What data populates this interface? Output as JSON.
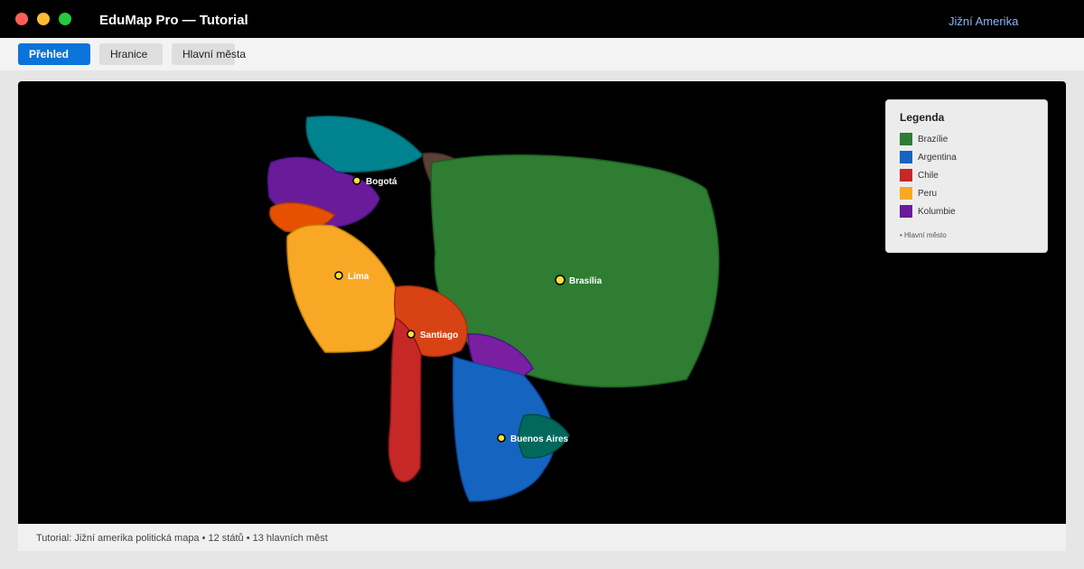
{
  "window": {
    "title": "EduMap Pro — Tutorial",
    "region": "Jižní Amerika",
    "region_color": "#8ab4f8"
  },
  "tabs": [
    {
      "label": "Přehled",
      "active": true,
      "bg": "#0a74da",
      "fg": "#ffffff"
    },
    {
      "label": "Hranice",
      "active": false,
      "bg": "#dedede",
      "fg": "#222222"
    },
    {
      "label": "Hlavní města",
      "active": false,
      "bg": "#dedede",
      "fg": "#222222"
    }
  ],
  "legend": {
    "title": "Legenda",
    "items": [
      {
        "label": "Brazílie",
        "color": "#2e7d32"
      },
      {
        "label": "Argentina",
        "color": "#1565c0"
      },
      {
        "label": "Chile",
        "color": "#c62828"
      },
      {
        "label": "Peru",
        "color": "#f9a825"
      },
      {
        "label": "Kolumbie",
        "color": "#6a1b9a"
      }
    ],
    "capital_note": "• Hlavní město"
  },
  "countries": [
    {
      "id": "venezuela",
      "color": "#00838f",
      "stroke": "#005f66"
    },
    {
      "id": "colombia",
      "color": "#6a1b9a",
      "stroke": "#4a148c"
    },
    {
      "id": "ecuador",
      "color": "#e65100",
      "stroke": "#b34000"
    },
    {
      "id": "guyana",
      "color": "#5d4037",
      "stroke": "#3e2a24"
    },
    {
      "id": "suriname",
      "color": "#455a64",
      "stroke": "#2f3e45"
    },
    {
      "id": "brazil",
      "color": "#2e7d32",
      "stroke": "#1b5e20"
    },
    {
      "id": "peru",
      "color": "#f9a825",
      "stroke": "#c58300"
    },
    {
      "id": "bolivia",
      "color": "#d84315",
      "stroke": "#a8300c"
    },
    {
      "id": "chile",
      "color": "#c62828",
      "stroke": "#8e1414"
    },
    {
      "id": "paraguay",
      "color": "#7b1fa2",
      "stroke": "#4a148c"
    },
    {
      "id": "argentina",
      "color": "#1565c0",
      "stroke": "#0d47a1"
    },
    {
      "id": "uruguay",
      "color": "#00695c",
      "stroke": "#004d40"
    }
  ],
  "capitals": [
    {
      "name": "Bogotá"
    },
    {
      "name": "Lima"
    },
    {
      "name": "Brasília"
    },
    {
      "name": "Santiago"
    },
    {
      "name": "Buenos Aires"
    }
  ],
  "status": {
    "text": "Tutorial: Jižní amerika politická mapa • 12 států • 13 hlavních měst"
  }
}
